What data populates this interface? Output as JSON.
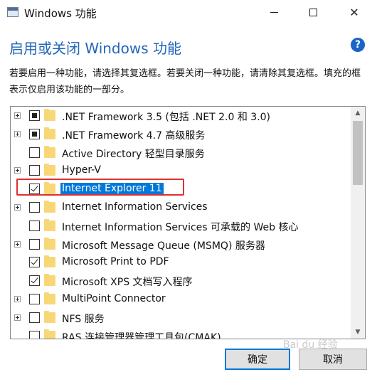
{
  "window": {
    "title": "Windows 功能",
    "minimize_icon": "minimize-icon",
    "maximize_icon": "maximize-icon",
    "close_icon": "close-icon",
    "close_glyph": "✕"
  },
  "heading": "启用或关闭 Windows 功能",
  "help_glyph": "?",
  "description": "若要启用一种功能，请选择其复选框。若要关闭一种功能，请清除其复选框。填充的框表示仅启用该功能的一部分。",
  "features": [
    {
      "label": ".NET Framework 3.5 (包括 .NET 2.0 和 3.0)",
      "state": "partial",
      "expandable": true,
      "selected": false
    },
    {
      "label": ".NET Framework 4.7 高级服务",
      "state": "partial",
      "expandable": true,
      "selected": false
    },
    {
      "label": "Active Directory 轻型目录服务",
      "state": "unchecked",
      "expandable": false,
      "selected": false
    },
    {
      "label": "Hyper-V",
      "state": "unchecked",
      "expandable": true,
      "selected": false
    },
    {
      "label": "Internet Explorer 11",
      "state": "checked",
      "expandable": false,
      "selected": true
    },
    {
      "label": "Internet Information Services",
      "state": "unchecked",
      "expandable": true,
      "selected": false
    },
    {
      "label": "Internet Information Services 可承载的 Web 核心",
      "state": "unchecked",
      "expandable": false,
      "selected": false
    },
    {
      "label": "Microsoft Message Queue (MSMQ) 服务器",
      "state": "unchecked",
      "expandable": true,
      "selected": false
    },
    {
      "label": "Microsoft Print to PDF",
      "state": "checked",
      "expandable": false,
      "selected": false
    },
    {
      "label": "Microsoft XPS 文档写入程序",
      "state": "checked",
      "expandable": false,
      "selected": false
    },
    {
      "label": "MultiPoint Connector",
      "state": "unchecked",
      "expandable": true,
      "selected": false
    },
    {
      "label": "NFS 服务",
      "state": "unchecked",
      "expandable": true,
      "selected": false
    },
    {
      "label": "RAS 连接管理器管理工具包(CMAK)",
      "state": "unchecked",
      "expandable": false,
      "selected": false
    }
  ],
  "scroll": {
    "up_glyph": "▲",
    "down_glyph": "▼"
  },
  "buttons": {
    "ok": "确定",
    "cancel": "取消"
  },
  "watermark": "Bai du 经验",
  "colors": {
    "accent": "#0078d7",
    "heading": "#2266b8",
    "highlight": "#e03030"
  }
}
